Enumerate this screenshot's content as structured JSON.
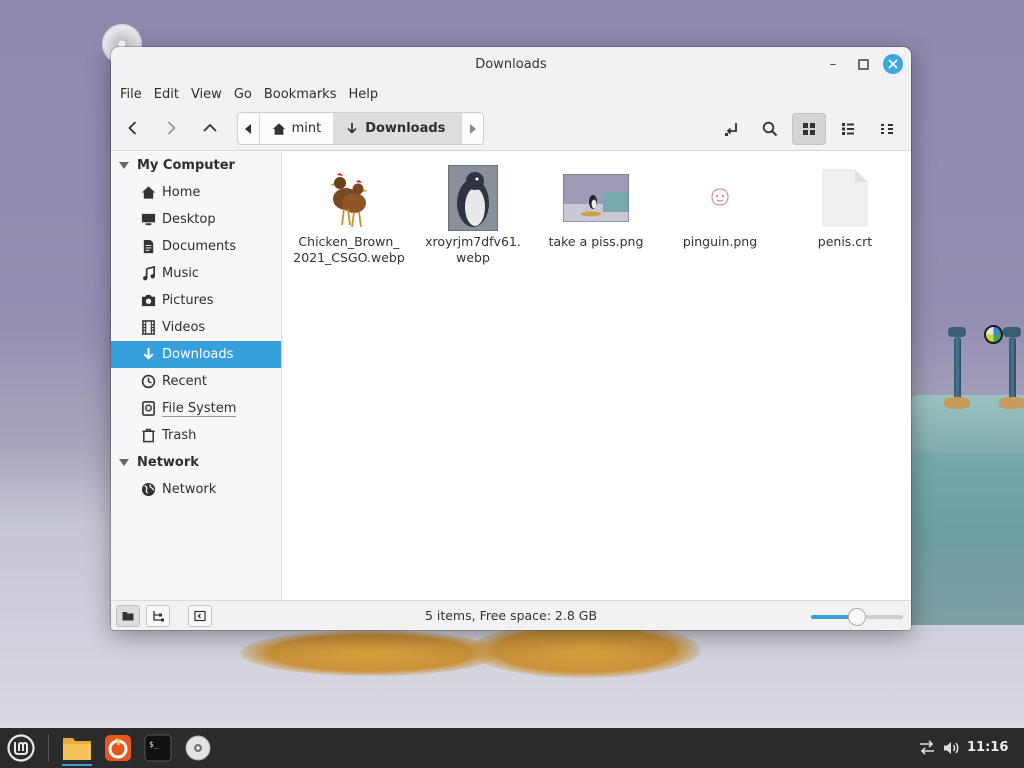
{
  "window": {
    "title": "Downloads",
    "controls": {
      "minimize": "–",
      "maximize": "□",
      "close": "✕"
    }
  },
  "menubar": {
    "items": [
      {
        "label": "File"
      },
      {
        "label": "Edit"
      },
      {
        "label": "View"
      },
      {
        "label": "Go"
      },
      {
        "label": "Bookmarks"
      },
      {
        "label": "Help"
      }
    ]
  },
  "toolbar": {
    "path": [
      {
        "label": "mint",
        "icon": "home-icon"
      },
      {
        "label": "Downloads",
        "icon": "download-icon",
        "active": true
      }
    ]
  },
  "sidebar": {
    "sections": [
      {
        "title": "My Computer",
        "items": [
          {
            "label": "Home",
            "icon": "home-icon"
          },
          {
            "label": "Desktop",
            "icon": "desktop-icon"
          },
          {
            "label": "Documents",
            "icon": "document-icon"
          },
          {
            "label": "Music",
            "icon": "music-icon"
          },
          {
            "label": "Pictures",
            "icon": "camera-icon"
          },
          {
            "label": "Videos",
            "icon": "film-icon"
          },
          {
            "label": "Downloads",
            "icon": "download-icon",
            "selected": true
          },
          {
            "label": "Recent",
            "icon": "clock-icon"
          },
          {
            "label": "File System",
            "icon": "drive-icon"
          },
          {
            "label": "Trash",
            "icon": "trash-icon"
          }
        ]
      },
      {
        "title": "Network",
        "items": [
          {
            "label": "Network",
            "icon": "globe-icon"
          }
        ]
      }
    ]
  },
  "files": [
    {
      "name": "Chicken_Brown_\n2021_CSGO.webp",
      "thumb": "chicken-image"
    },
    {
      "name": "xroyrjm7dfv61.\nwebp",
      "thumb": "penguin-image"
    },
    {
      "name": "take a piss.png",
      "thumb": "bathroom-image"
    },
    {
      "name": "pinguin.png",
      "thumb": "pinguin-sketch-image"
    },
    {
      "name": "penis.crt",
      "thumb": "generic-file-icon"
    }
  ],
  "statusbar": {
    "text": "5 items, Free space: 2.8 GB",
    "zoom_level": 0.5
  },
  "taskbar": {
    "clock": "11:16",
    "accent": "#35a0dc"
  }
}
